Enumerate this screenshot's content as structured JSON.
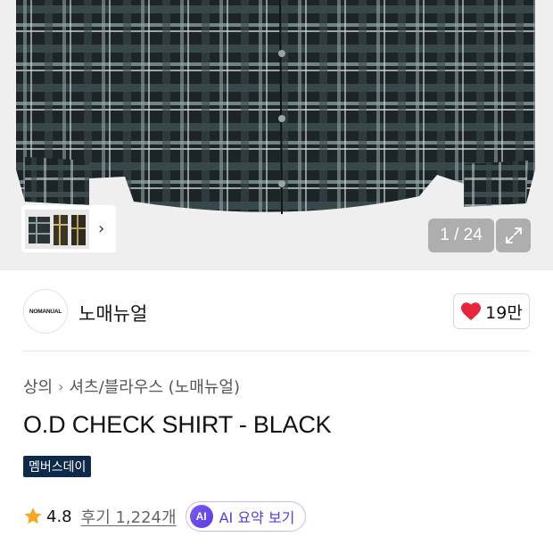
{
  "gallery": {
    "counter": "1 / 24",
    "product_image": "plaid-shirt-photo",
    "thumbnail": "product-thumbnails",
    "thumb_next_icon": "chevron-right-icon",
    "expand_icon": "expand-icon"
  },
  "brand": {
    "logo_text": "NOMANUAL",
    "name": "노매뉴얼",
    "like_icon": "heart-icon",
    "like_color": "#e8233a",
    "like_count": "19만"
  },
  "breadcrumb": {
    "items": [
      "상의",
      "셔츠/블라우스 (노매뉴얼)"
    ],
    "separator_icon": "chevron-right-icon"
  },
  "product": {
    "title": "O.D CHECK SHIRT - BLACK",
    "badge": "멤버스데이",
    "badge_color": "#0d2a4a"
  },
  "rating": {
    "star_icon": "star-icon",
    "star_color": "#f5a623",
    "value": "4.8",
    "review_link": "후기 1,224개",
    "ai_icon_text": "AI",
    "ai_button_label": "AI 요약 보기"
  }
}
